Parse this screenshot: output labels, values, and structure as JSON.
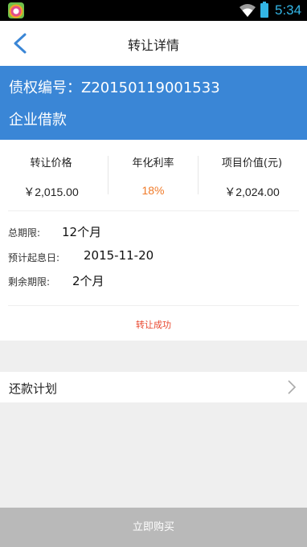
{
  "statusbar": {
    "time": "5:34"
  },
  "nav": {
    "title": "转让详情"
  },
  "hero": {
    "id_text": "债权编号：Z20150119001533",
    "type": "企业借款"
  },
  "stats": [
    {
      "label": "转让价格",
      "value": "￥2,015.00"
    },
    {
      "label": "年化利率",
      "value": "18%"
    },
    {
      "label": "项目价值(元)",
      "value": "￥2,024.00"
    }
  ],
  "details": [
    {
      "label": "总期限:",
      "value": "12个月"
    },
    {
      "label": "预计起息日:",
      "value": "2015-11-20"
    },
    {
      "label": "剩余期限:",
      "value": "2个月"
    }
  ],
  "status_text": "转让成功",
  "repayment": {
    "label": "还款计划"
  },
  "buy_button": {
    "label": "立即购买"
  },
  "colors": {
    "hero_bg": "#3a86d6",
    "rate_accent": "#f07a28",
    "status_red": "#e8452c",
    "button_disabled": "#b9b9b9"
  }
}
